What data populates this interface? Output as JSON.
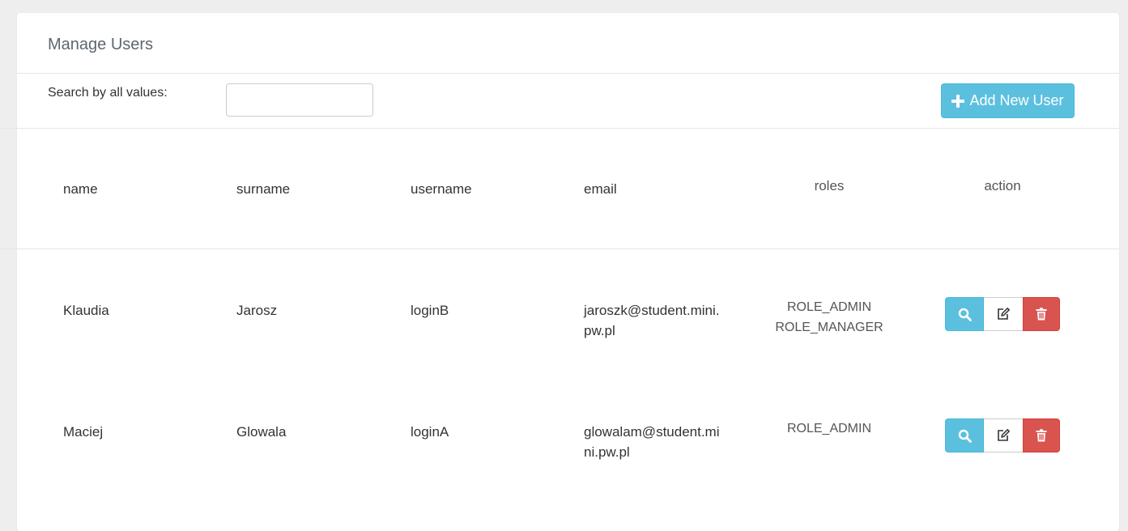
{
  "page": {
    "title": "Manage Users"
  },
  "toolbar": {
    "search_label": "Search by all values:",
    "search_value": "",
    "search_placeholder": "",
    "add_button_label": "Add New User"
  },
  "table": {
    "columns": [
      "name",
      "surname",
      "username",
      "email",
      "roles",
      "action"
    ],
    "rows": [
      {
        "name": "Klaudia",
        "surname": "Jarosz",
        "username": "loginB",
        "email_line1": "jaroszk@student.mini.",
        "email_line2": "pw.pl",
        "roles": [
          "ROLE_ADMIN",
          "ROLE_MANAGER"
        ]
      },
      {
        "name": "Maciej",
        "surname": "Glowala",
        "username": "loginA",
        "email_line1": "glowalam@student.mi",
        "email_line2": "ni.pw.pl",
        "roles": [
          "ROLE_ADMIN"
        ]
      }
    ]
  },
  "icons": {
    "add": "plus-icon",
    "view": "search-icon",
    "edit": "edit-icon",
    "delete": "trash-icon"
  },
  "colors": {
    "info": "#5bc0de",
    "danger": "#d9534f",
    "background": "#eeeeee"
  }
}
